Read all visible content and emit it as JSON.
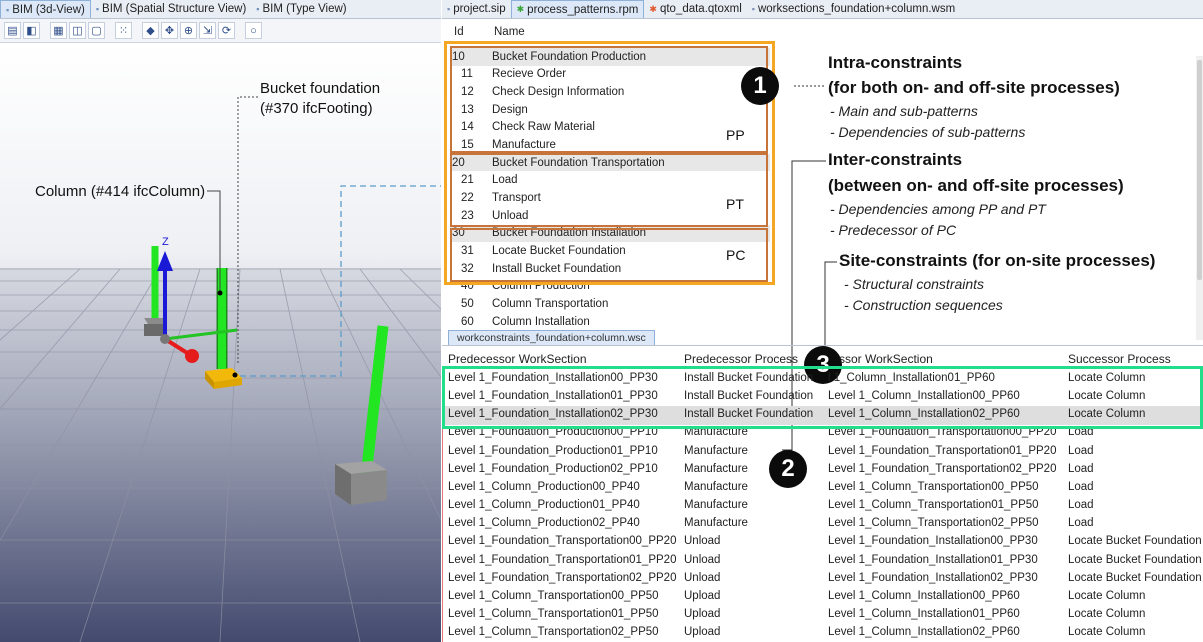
{
  "left_tabs": [
    {
      "label": "BIM (3d-View)",
      "active": true
    },
    {
      "label": "BIM (Spatial Structure View)"
    },
    {
      "label": "BIM (Type View)"
    }
  ],
  "right_tabs": [
    {
      "label": "project.sip"
    },
    {
      "label": "process_patterns.rpm",
      "active": true
    },
    {
      "label": "qto_data.qtoxml"
    },
    {
      "label": "worksections_foundation+column.wsm"
    }
  ],
  "viewport_labels": {
    "bucket_foundation_line1": "Bucket foundation",
    "bucket_foundation_line2": "(#370 ifcFooting)",
    "column": "Column (#414 ifcColumn)",
    "axis_z": "Z"
  },
  "process_table": {
    "header_id": "Id",
    "header_name": "Name",
    "rows": [
      {
        "id": "10",
        "name": "Bucket Foundation Production",
        "main": true
      },
      {
        "id": "11",
        "name": "Recieve Order"
      },
      {
        "id": "12",
        "name": "Check Design Information"
      },
      {
        "id": "13",
        "name": "Design"
      },
      {
        "id": "14",
        "name": "Check Raw Material"
      },
      {
        "id": "15",
        "name": "Manufacture"
      },
      {
        "id": "20",
        "name": "Bucket Foundation Transportation",
        "main": true
      },
      {
        "id": "21",
        "name": "Load"
      },
      {
        "id": "22",
        "name": "Transport"
      },
      {
        "id": "23",
        "name": "Unload"
      },
      {
        "id": "30",
        "name": "Bucket Foundation Installation",
        "main": true
      },
      {
        "id": "31",
        "name": "Locate Bucket Foundation"
      },
      {
        "id": "32",
        "name": "Install Bucket Foundation"
      },
      {
        "id": "40",
        "name": "Column Production",
        "main": true
      },
      {
        "id": "50",
        "name": "Column Transportation",
        "main": true
      },
      {
        "id": "60",
        "name": "Column Installation",
        "main": true
      }
    ],
    "groups": {
      "pp": "PP",
      "pt": "PT",
      "pc": "PC"
    }
  },
  "annotations": {
    "b1": "1",
    "b2": "2",
    "b3": "3",
    "intra_title1": "Intra-constraints",
    "intra_title2": "(for both on- and off-site processes)",
    "intra_sub1": "- Main and sub-patterns",
    "intra_sub2": "- Dependencies of sub-patterns",
    "inter_title1": "Inter-constraints",
    "inter_title2": "(between on- and off-site processes)",
    "inter_sub1": "- Dependencies among PP and PT",
    "inter_sub2": "- Predecessor of PC",
    "site_title": "Site-constraints (for on-site processes)",
    "site_sub1": "- Structural constraints",
    "site_sub2": "- Construction sequences"
  },
  "workconstraints": {
    "tab_label": "workconstraints_foundation+column.wsc",
    "headers": [
      "Predecessor WorkSection",
      "Predecessor Process",
      "ssor WorkSection",
      "Successor Process"
    ],
    "rows": [
      [
        "Level 1_Foundation_Installation00_PP30",
        "Install Bucket Foundation",
        "l 1_Column_Installation01_PP60",
        "Locate Column"
      ],
      [
        "Level 1_Foundation_Installation01_PP30",
        "Install Bucket Foundation",
        "Level 1_Column_Installation00_PP60",
        "Locate Column"
      ],
      [
        "Level 1_Foundation_Installation02_PP30",
        "Install Bucket Foundation",
        "Level 1_Column_Installation02_PP60",
        "Locate Column"
      ],
      [
        "Level 1_Foundation_Production00_PP10",
        "Manufacture",
        "Level 1_Foundation_Transportation00_PP20",
        "Load"
      ],
      [
        "Level 1_Foundation_Production01_PP10",
        "Manufacture",
        "Level 1_Foundation_Transportation01_PP20",
        "Load"
      ],
      [
        "Level 1_Foundation_Production02_PP10",
        "Manufacture",
        "Level 1_Foundation_Transportation02_PP20",
        "Load"
      ],
      [
        "Level 1_Column_Production00_PP40",
        "Manufacture",
        "Level 1_Column_Transportation00_PP50",
        "Load"
      ],
      [
        "Level 1_Column_Production01_PP40",
        "Manufacture",
        "Level 1_Column_Transportation01_PP50",
        "Load"
      ],
      [
        "Level 1_Column_Production02_PP40",
        "Manufacture",
        "Level 1_Column_Transportation02_PP50",
        "Load"
      ],
      [
        "Level 1_Foundation_Transportation00_PP20",
        "Unload",
        "Level 1_Foundation_Installation00_PP30",
        "Locate Bucket Foundation"
      ],
      [
        "Level 1_Foundation_Transportation01_PP20",
        "Unload",
        "Level 1_Foundation_Installation01_PP30",
        "Locate Bucket Foundation"
      ],
      [
        "Level 1_Foundation_Transportation02_PP20",
        "Unload",
        "Level 1_Foundation_Installation02_PP30",
        "Locate Bucket Foundation"
      ],
      [
        "Level 1_Column_Transportation00_PP50",
        "Upload",
        "Level 1_Column_Installation00_PP60",
        "Locate Column"
      ],
      [
        "Level 1_Column_Transportation01_PP50",
        "Upload",
        "Level 1_Column_Installation01_PP60",
        "Locate Column"
      ],
      [
        "Level 1_Column_Transportation02_PP50",
        "Upload",
        "Level 1_Column_Installation02_PP60",
        "Locate Column"
      ]
    ]
  },
  "colors": {
    "orange": "#f5a623",
    "brown": "#c6743a",
    "green": "#22dd8a",
    "red_line": "#e57878",
    "column_green": "#22e622",
    "selection": "#dedede"
  }
}
